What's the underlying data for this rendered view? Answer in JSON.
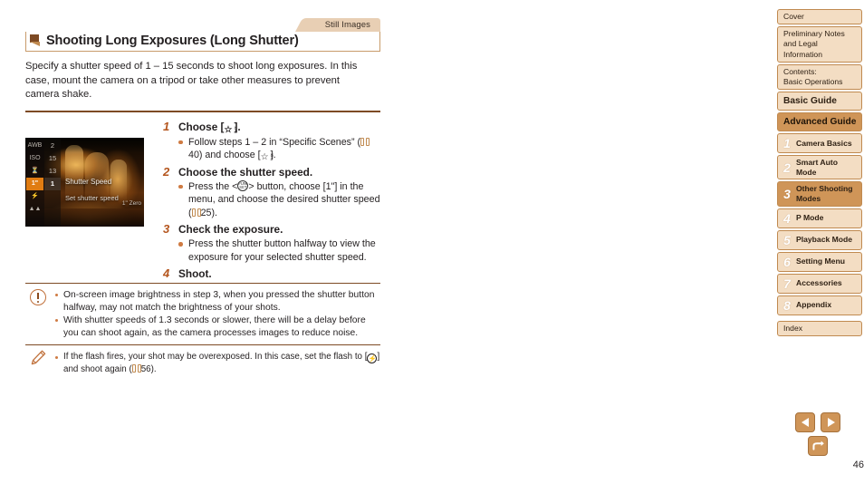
{
  "page": {
    "number": "46",
    "tab_label": "Still Images",
    "title": "Shooting Long Exposures (Long Shutter)",
    "intro": "Specify a shutter speed of 1 – 15 seconds to shoot long exposures. In this case, mount the camera on a tripod or take other measures to prevent camera shake."
  },
  "steps": [
    {
      "num": "1",
      "title_prefix": "Choose [",
      "title_icon": "long-shutter-mode-icon",
      "title_suffix": "].",
      "bullets": [
        {
          "pre": "Follow steps 1 – 2 in “Specific Scenes” (",
          "page_ref": "40",
          "mid": ") and choose [",
          "icon": "long-shutter-mode-icon",
          "post": "]."
        }
      ]
    },
    {
      "num": "2",
      "title": "Choose the shutter speed.",
      "bullets": [
        {
          "pre": "Press the <",
          "icon": "func-set-button-icon",
          "mid": "> button, choose [1\"] in the menu, and choose the desired shutter speed (",
          "page_ref": "25",
          "post": ")."
        }
      ]
    },
    {
      "num": "3",
      "title": "Check the exposure.",
      "bullets": [
        {
          "text": "Press the shutter button halfway to view the exposure for your selected shutter speed."
        }
      ]
    },
    {
      "num": "4",
      "title": "Shoot.",
      "bullets": []
    }
  ],
  "lcd": {
    "menu_icons": [
      "AWB",
      "ISO",
      "drive-icon",
      "1\"",
      "flash-icon",
      "macro-icon"
    ],
    "menu_values": [
      "2",
      "15",
      "13",
      "1"
    ],
    "selected_icon": "1\"",
    "selected_value": "1",
    "label_title": "Shutter Speed",
    "label_sub": "Set shutter speed",
    "corner_text": "1\" Zero"
  },
  "caution": {
    "icon": "caution-icon",
    "items": [
      "On-screen image brightness in step 3, when you pressed the shutter button halfway, may not match the brightness of your shots.",
      "With shutter speeds of 1.3 seconds or slower, there will be a delay before you can shoot again, as the camera processes images to reduce noise."
    ]
  },
  "tip": {
    "icon": "pencil-tip-icon",
    "pre": "If the flash fires, your shot may be overexposed. In this case, set the flash to [",
    "icon_inline": "flash-off-icon",
    "mid": "] and shoot again (",
    "page_ref": "56",
    "post": ")."
  },
  "sidebar": {
    "items": [
      {
        "label": "Cover",
        "style": "plain",
        "active": false
      },
      {
        "label": "Preliminary Notes and Legal Information",
        "style": "plain",
        "active": false
      },
      {
        "label": "Contents:\nBasic Operations",
        "style": "plain",
        "active": false
      },
      {
        "label": "Basic Guide",
        "style": "big",
        "active": false
      },
      {
        "label": "Advanced Guide",
        "style": "big",
        "active": true
      }
    ],
    "chapters": [
      {
        "num": "1",
        "label": "Camera Basics",
        "active": false
      },
      {
        "num": "2",
        "label": "Smart Auto Mode",
        "active": false
      },
      {
        "num": "3",
        "label": "Other Shooting Modes",
        "active": true
      },
      {
        "num": "4",
        "label": "P Mode",
        "active": false
      },
      {
        "num": "5",
        "label": "Playback Mode",
        "active": false
      },
      {
        "num": "6",
        "label": "Setting Menu",
        "active": false
      },
      {
        "num": "7",
        "label": "Accessories",
        "active": false
      },
      {
        "num": "8",
        "label": "Appendix",
        "active": false
      }
    ],
    "index": {
      "label": "Index",
      "active": false
    }
  },
  "nav": {
    "prev": "previous-page-icon",
    "next": "next-page-icon",
    "back": "back-icon"
  },
  "colors": {
    "accent_brown": "#7d4a24",
    "accent_orange": "#b4551d",
    "tab_tan": "#e8cfb4",
    "sidebar_tan": "#f3ddc3",
    "sidebar_active": "#cf9558",
    "border_tan": "#c08a50"
  }
}
